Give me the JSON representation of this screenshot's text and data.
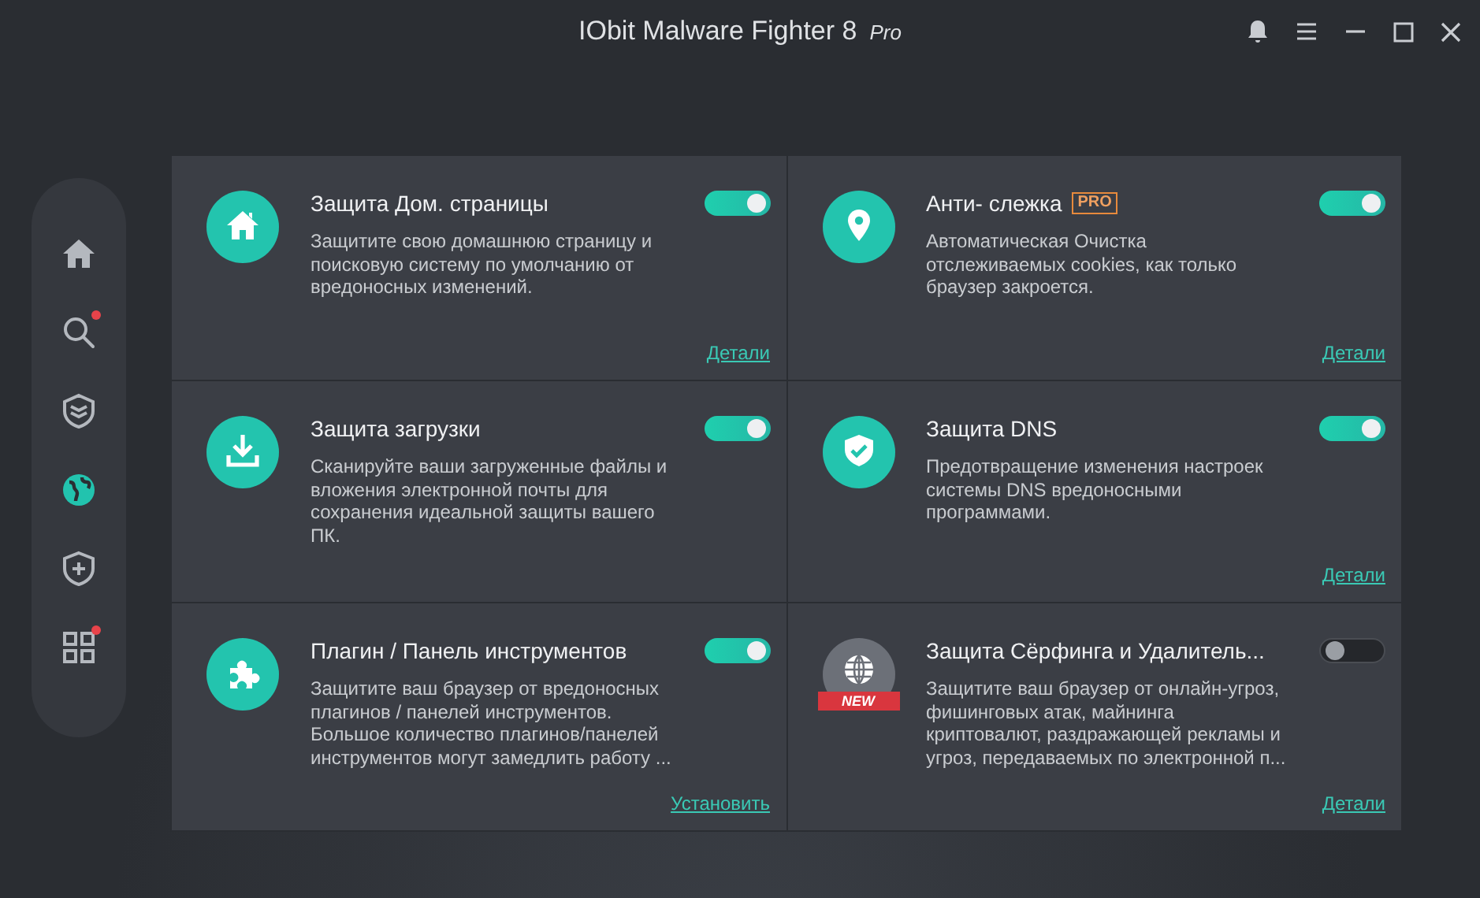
{
  "window": {
    "title": "IObit Malware Fighter 8",
    "edition": "Pro"
  },
  "sidebar": {
    "items": [
      {
        "selected": false,
        "dot": false
      },
      {
        "selected": false,
        "dot": true
      },
      {
        "selected": false,
        "dot": false
      },
      {
        "selected": true,
        "dot": false
      },
      {
        "selected": false,
        "dot": false
      },
      {
        "selected": false,
        "dot": true
      }
    ]
  },
  "cards": [
    {
      "title": "Защита Дом. страницы",
      "on": true,
      "description": "Защитите свою домашнюю страницу и поисковую систему по умолчанию от вредоносных изменений.",
      "link": "Детали"
    },
    {
      "title": "Анти- слежка",
      "badge": "PRO",
      "on": true,
      "description": "Автоматическая Очистка отслеживаемых cookies, как только браузер закроется.",
      "link": "Детали"
    },
    {
      "title": "Защита загрузки",
      "on": true,
      "description": "Сканируйте ваши загруженные файлы и вложения электронной почты для сохранения идеальной защиты вашего ПК."
    },
    {
      "title": "Защита DNS",
      "on": true,
      "description": "Предотвращение изменения настроек системы DNS вредоносными программами.",
      "link": "Детали"
    },
    {
      "title": "Плагин / Панель инструментов",
      "on": true,
      "description": "Защитите ваш браузер от вредоносных плагинов / панелей инструментов. Большое количество плагинов/панелей инструментов могут замедлить работу ...",
      "link": "Установить"
    },
    {
      "ribbon": "NEW",
      "title": "Защита Сёрфинга и Удалитель...",
      "on": false,
      "description": "Защитите ваш браузер от онлайн-угроз, фишинговых атак, майнинга криптовалют, раздражающей рекламы и угроз, передаваемых по электронной п...",
      "link": "Детали"
    }
  ]
}
